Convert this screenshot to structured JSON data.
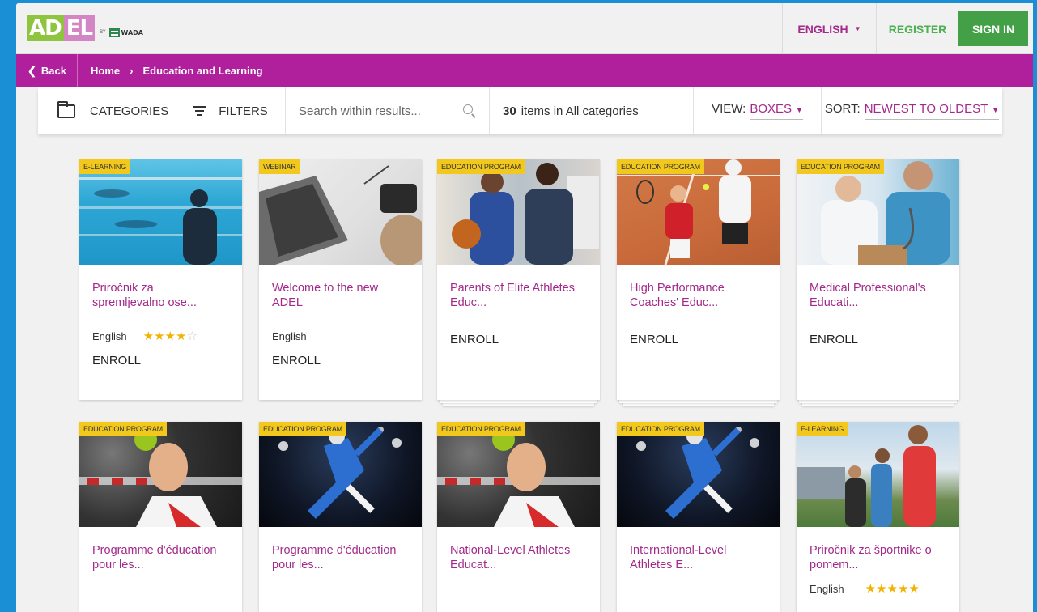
{
  "header": {
    "logo_ad": "AD",
    "logo_el": "EL",
    "logo_by": "BY",
    "logo_wada": "WADA",
    "language": "ENGLISH",
    "register": "REGISTER",
    "sign_in": "SIGN IN"
  },
  "breadcrumb": {
    "back": "Back",
    "home": "Home",
    "separator": "›",
    "current": "Education and Learning"
  },
  "filters": {
    "categories": "CATEGORIES",
    "filters": "FILTERS",
    "search_placeholder": "Search within results...",
    "count_number": "30",
    "count_text": "items in All categories",
    "view_label": "VIEW:",
    "view_value": "BOXES",
    "sort_label": "SORT:",
    "sort_value": "NEWEST TO OLDEST"
  },
  "colors": {
    "brand_magenta": "#b01f9c",
    "accent_text": "#a3298a",
    "sign_in_green": "#43a047",
    "badge_yellow": "#f2c81c"
  },
  "cards": [
    {
      "badge": "E-LEARNING",
      "title_1": "Priročnik za",
      "title_2": "spremljevalno ose...",
      "language": "English",
      "rating": 4,
      "enroll": "ENROLL"
    },
    {
      "badge": "WEBINAR",
      "title_1": "Welcome to the new",
      "title_2": "ADEL",
      "language": "English",
      "enroll": "ENROLL"
    },
    {
      "badge": "EDUCATION PROGRAM",
      "title_1": "Parents of Elite Athletes",
      "title_2": "Educ...",
      "enroll": "ENROLL"
    },
    {
      "badge": "EDUCATION PROGRAM",
      "title_1": "High Performance",
      "title_2": "Coaches' Educ...",
      "enroll": "ENROLL"
    },
    {
      "badge": "EDUCATION PROGRAM",
      "title_1": "Medical Professional's",
      "title_2": "Educati...",
      "enroll": "ENROLL"
    },
    {
      "badge": "EDUCATION PROGRAM",
      "title_1": "Programme d'éducation",
      "title_2": "pour les..."
    },
    {
      "badge": "EDUCATION PROGRAM",
      "title_1": "Programme d'éducation",
      "title_2": "pour les..."
    },
    {
      "badge": "EDUCATION PROGRAM",
      "title_1": "National-Level Athletes",
      "title_2": "Educat..."
    },
    {
      "badge": "EDUCATION PROGRAM",
      "title_1": "International-Level",
      "title_2": "Athletes E..."
    },
    {
      "badge": "E-LEARNING",
      "title_1": "Priročnik za športnike o",
      "title_2": "pomem...",
      "language": "English",
      "rating": 5
    }
  ],
  "stars": {
    "full4": "★★★★",
    "empty1": "☆",
    "full5": "★★★★★"
  }
}
